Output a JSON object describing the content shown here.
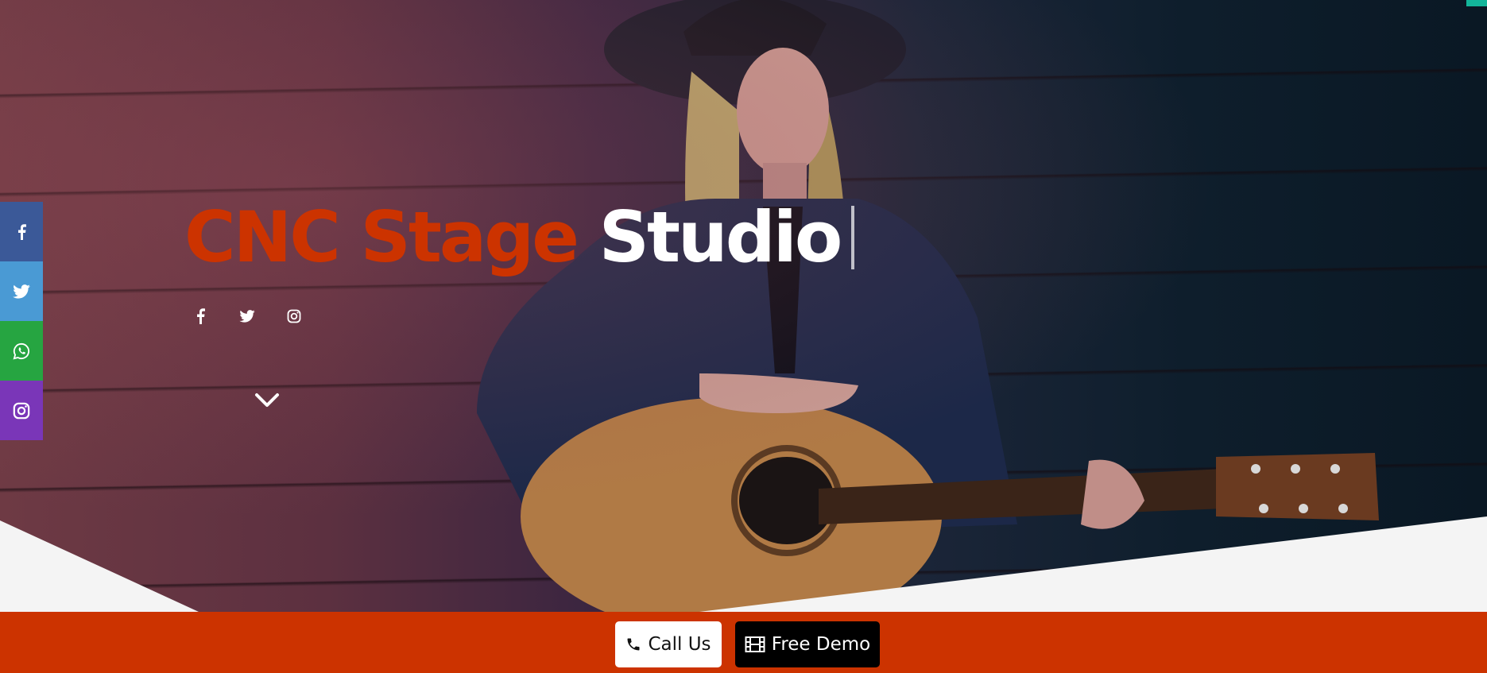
{
  "brand": {
    "part1": "CNC",
    "part2": "Stage",
    "part3": "Studio"
  },
  "hero_social": [
    {
      "name": "facebook-icon"
    },
    {
      "name": "twitter-icon"
    },
    {
      "name": "instagram-icon"
    }
  ],
  "side_social": [
    {
      "name": "facebook-icon",
      "color": "#3b5998"
    },
    {
      "name": "twitter-icon",
      "color": "#4a9ad4"
    },
    {
      "name": "whatsapp-icon",
      "color": "#26a541"
    },
    {
      "name": "instagram-icon",
      "color": "#7a36b8"
    }
  ],
  "cta": {
    "call_label": "Call Us",
    "demo_label": "Free Demo"
  },
  "colors": {
    "accent": "#cc3300",
    "bar": "#cc3300",
    "badge": "#13b59a"
  }
}
